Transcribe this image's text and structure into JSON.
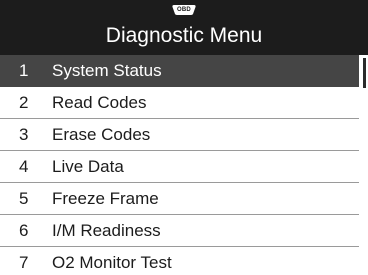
{
  "header": {
    "badge_text": "OBD",
    "title": "Diagnostic Menu"
  },
  "menu": {
    "selected_index": 0,
    "items": [
      {
        "number": "1",
        "label": "System Status"
      },
      {
        "number": "2",
        "label": "Read Codes"
      },
      {
        "number": "3",
        "label": "Erase Codes"
      },
      {
        "number": "4",
        "label": "Live Data"
      },
      {
        "number": "5",
        "label": "Freeze Frame"
      },
      {
        "number": "6",
        "label": "I/M Readiness"
      },
      {
        "number": "7",
        "label": "O2 Monitor Test"
      }
    ]
  },
  "colors": {
    "header_bg": "#1c1c1c",
    "selected_bg": "#454545",
    "text": "#1c1c1c",
    "divider": "#9a9a9a"
  }
}
